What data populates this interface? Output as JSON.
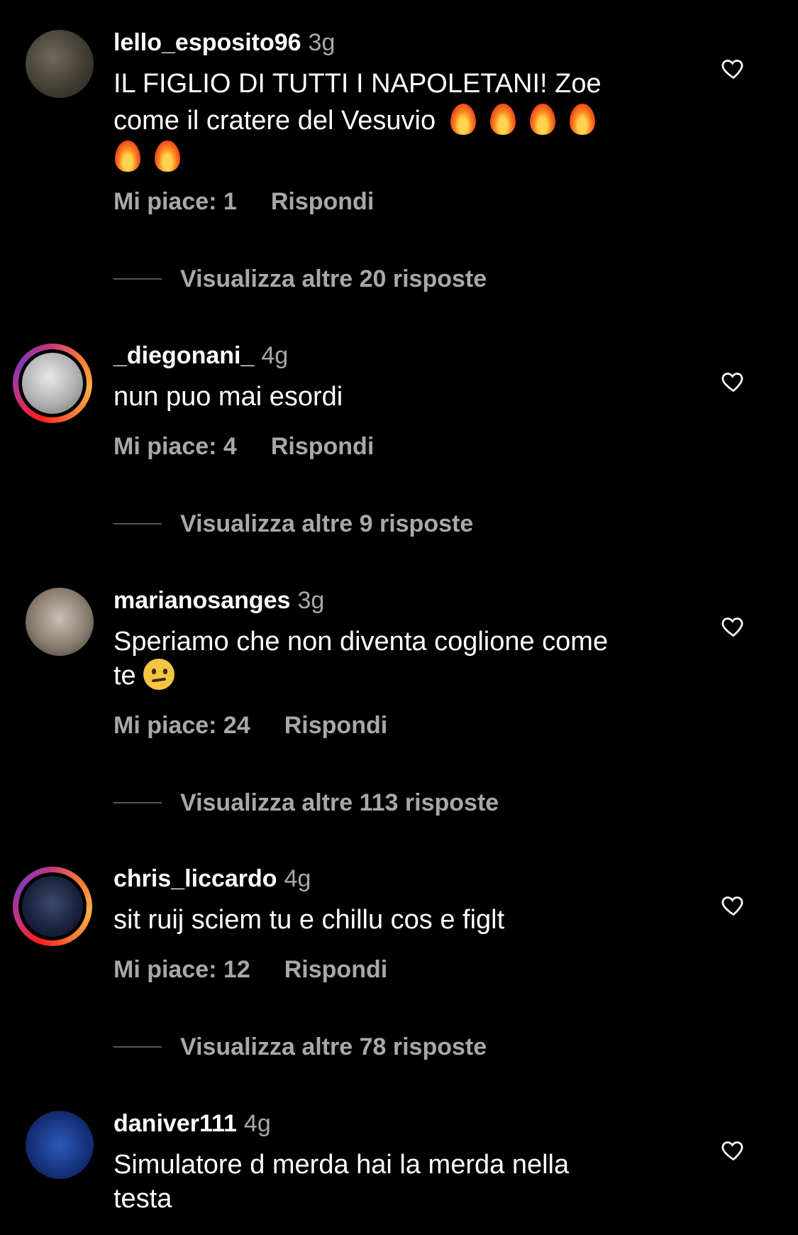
{
  "comments": [
    {
      "username": "lello_esposito96",
      "time": "3g",
      "text_lines": [
        "IL FIGLIO DI TUTTI I NAPOLETANI! Zoe",
        "come il cratere del Vesuvio"
      ],
      "emoji": "🔥🔥🔥🔥🔥🔥",
      "likes": "Mi piace: 1",
      "reply": "Rispondi",
      "more_replies": "Visualizza altre 20 risposte"
    },
    {
      "username": "_diegonani_",
      "time": "4g",
      "text_lines": [
        "nun puo mai esordi"
      ],
      "likes": "Mi piace: 4",
      "reply": "Rispondi",
      "more_replies": "Visualizza altre 9 risposte"
    },
    {
      "username": "marianosanges",
      "time": "3g",
      "text_lines": [
        "Speriamo che non diventa coglione come",
        "te"
      ],
      "emoji": "😕",
      "likes": "Mi piace: 24",
      "reply": "Rispondi",
      "more_replies": "Visualizza altre 113 risposte"
    },
    {
      "username": "chris_liccardo",
      "time": "4g",
      "text_lines": [
        "sit ruij sciem tu e chillu cos e figlt"
      ],
      "likes": "Mi piace: 12",
      "reply": "Rispondi",
      "more_replies": "Visualizza altre 78 risposte"
    },
    {
      "username": "daniver111",
      "time": "4g",
      "text_lines": [
        "Simulatore d merda hai la merda nella",
        "testa"
      ]
    }
  ],
  "icons": {
    "like": "heart-outline-icon"
  },
  "colors": {
    "background": "#000000",
    "text": "#ffffff",
    "secondary": "#a8a8a8"
  }
}
